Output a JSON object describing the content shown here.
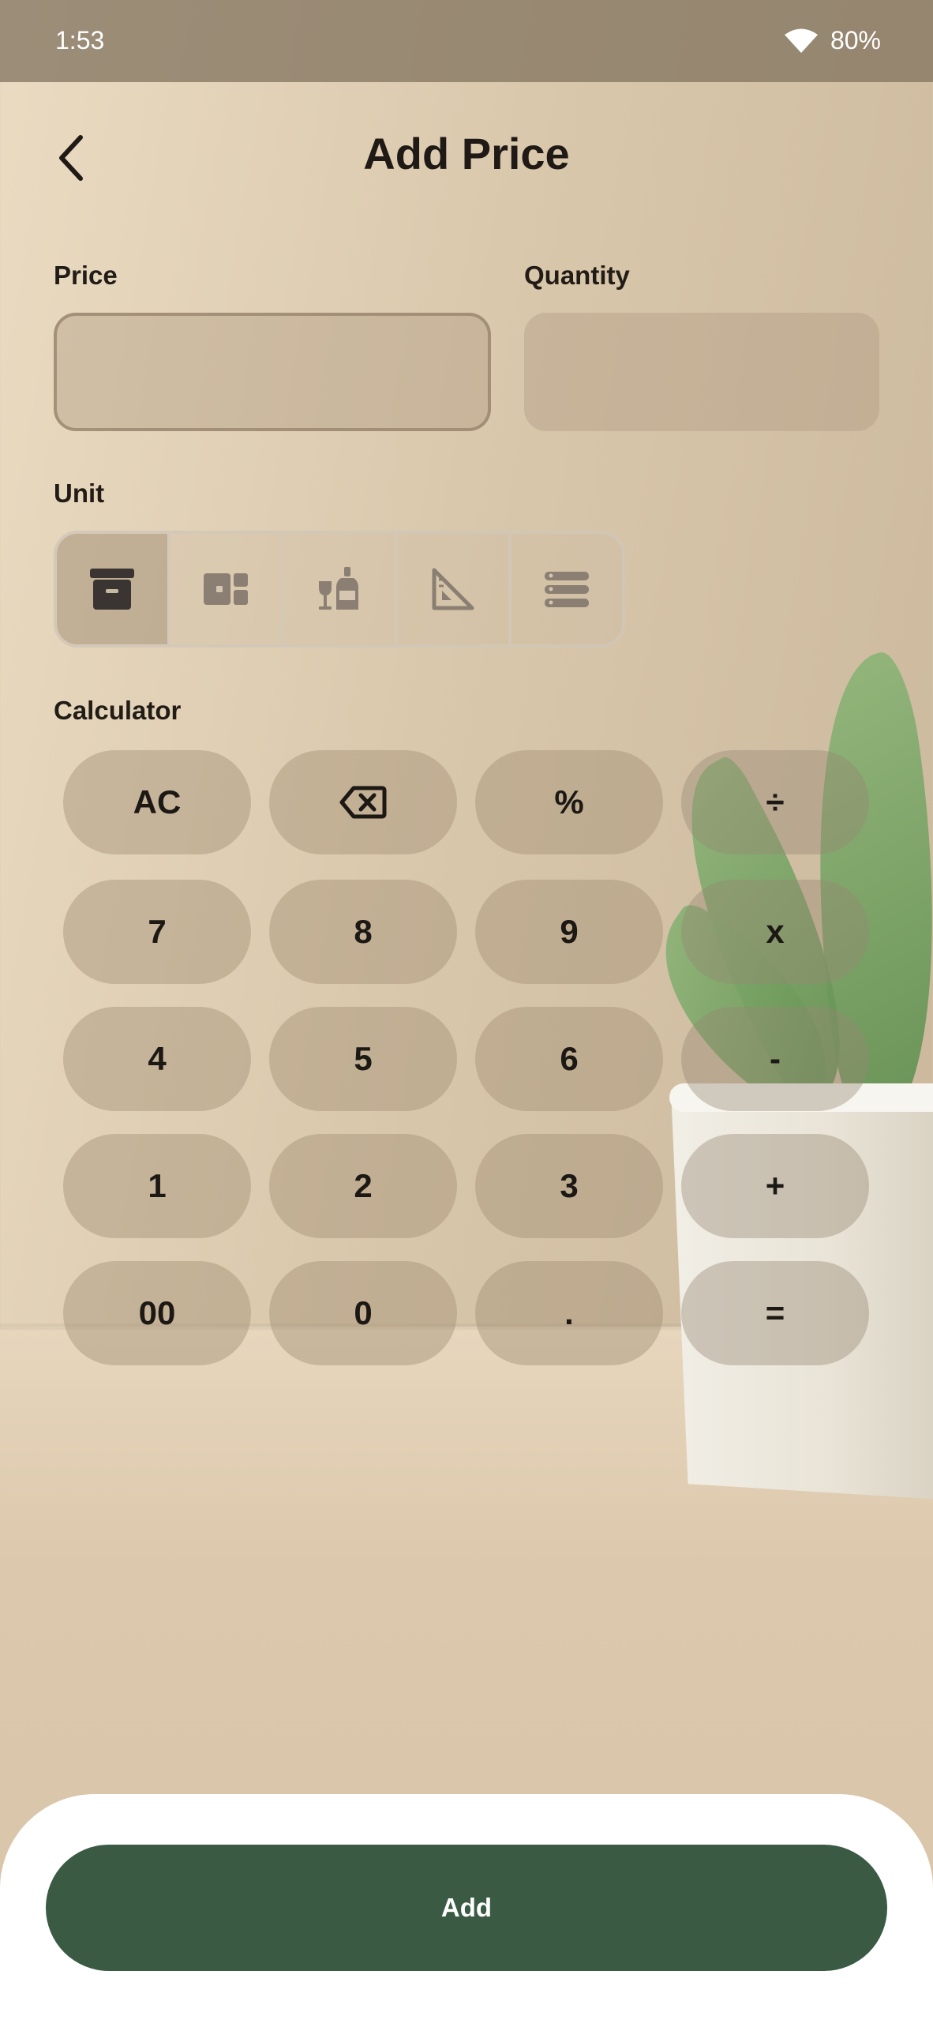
{
  "status_bar": {
    "time": "1:53",
    "battery": "80%"
  },
  "header": {
    "title": "Add Price"
  },
  "form": {
    "price_label": "Price",
    "price_value": "",
    "quantity_label": "Quantity",
    "quantity_value": "",
    "unit_label": "Unit",
    "calculator_label": "Calculator"
  },
  "units": [
    {
      "icon": "box-icon",
      "selected": true
    },
    {
      "icon": "package-icon",
      "selected": false
    },
    {
      "icon": "bottles-icon",
      "selected": false
    },
    {
      "icon": "ruler-triangle-icon",
      "selected": false
    },
    {
      "icon": "list-icon",
      "selected": false
    }
  ],
  "calculator": {
    "keys": [
      [
        "AC",
        "backspace",
        "%",
        "÷"
      ],
      [
        "7",
        "8",
        "9",
        "x"
      ],
      [
        "4",
        "5",
        "6",
        "-"
      ],
      [
        "1",
        "2",
        "3",
        "+"
      ],
      [
        "00",
        "0",
        ".",
        "="
      ]
    ]
  },
  "actions": {
    "add_label": "Add"
  },
  "colors": {
    "accent": "#3a5a43"
  }
}
